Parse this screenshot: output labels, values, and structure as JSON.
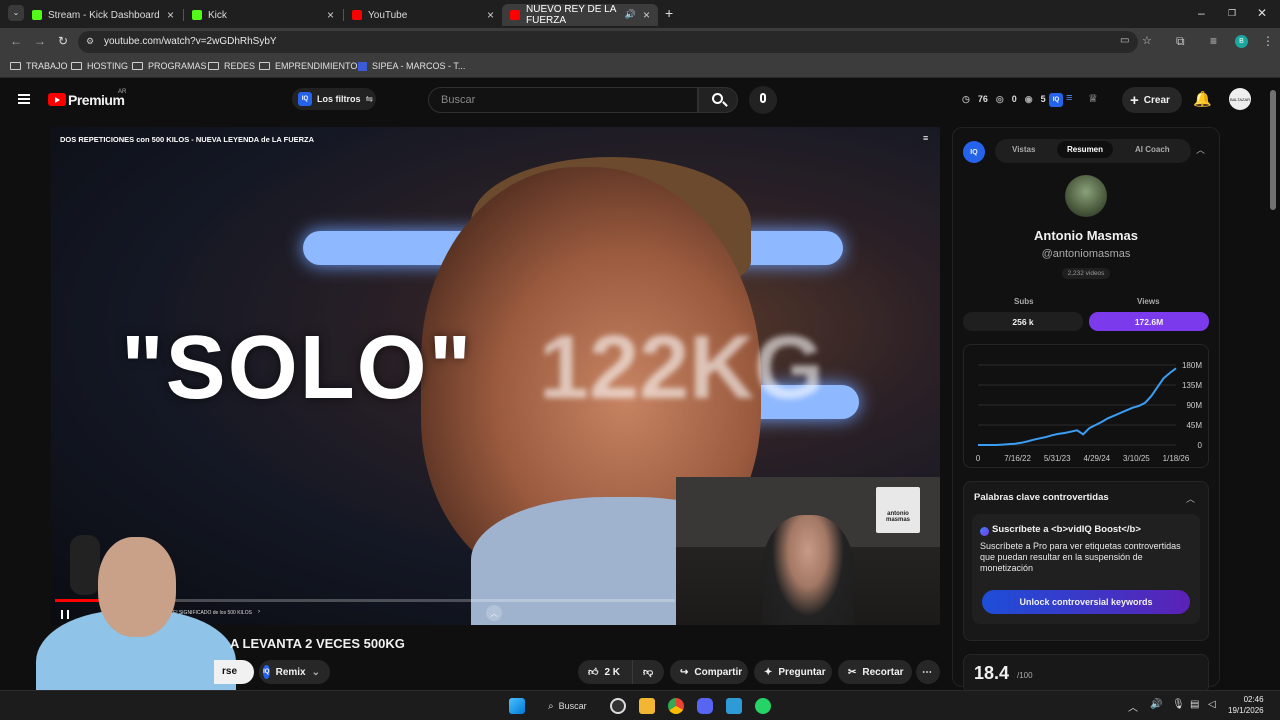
{
  "tabs": [
    {
      "title": "Stream - Kick Dashboard",
      "color": "#53fc18"
    },
    {
      "title": "Kick",
      "color": "#53fc18"
    },
    {
      "title": "YouTube",
      "color": "#ff0000"
    },
    {
      "title": "NUEVO REY DE LA FUERZA",
      "color": "#ff0000"
    }
  ],
  "address": {
    "url": "youtube.com/watch?v=2wGDhRhSybY"
  },
  "bookmarks": [
    "TRABAJO",
    "HOSTING",
    "PROGRAMAS",
    "REDES",
    "EMPRENDIMIENTOS",
    "SIPEA - MARCOS - T..."
  ],
  "youtube": {
    "brand": "Premium",
    "region": "AR",
    "filters_label": "Los filtros",
    "search_placeholder": "Buscar",
    "stats": {
      "time": "76",
      "a": "0",
      "b": "5"
    },
    "create_label": "Crear",
    "avatar_text": "BALTAZAR"
  },
  "video": {
    "overlay_title": "DOS REPETICIONES con 500 KILOS - NUEVA LEYENDA de LA FUERZA",
    "big_text": "\"SOLO\"",
    "big_text_blur": "122KG",
    "progress": 0.19,
    "chapter": "El SIGNIFICADO de los 500 KILOS",
    "time_fragment": "5",
    "cam_sign": "antonio masmas"
  },
  "below": {
    "title_fragment": "A LEVANTA 2 VECES 500KG",
    "subscribe_fragment": "rse",
    "remix": "Remix",
    "likes": "2 K",
    "share": "Compartir",
    "ask": "Preguntar",
    "clip": "Recortar"
  },
  "panel": {
    "iq": "IQ",
    "tabs": [
      "Vistas",
      "Resumen",
      "AI Coach"
    ],
    "active_tab": "Resumen",
    "channel_name": "Antonio Masmas",
    "handle": "@antoniomasmas",
    "videos": "2,232 videos",
    "subs_label": "Subs",
    "subs_value": "256 k",
    "views_label": "Views",
    "views_value": "172.6M",
    "keywords_title": "Palabras clave controvertidas",
    "boost_title": "Suscríbete a <b>vidIQ Boost</b>",
    "boost_desc": "Suscríbete a Pro para ver etiquetas controvertidas que puedan resultar en la suspensión de monetización",
    "unlock_label": "Unlock controversial keywords",
    "score": "18.4",
    "score_max": "/100",
    "accent": "#7c3aed"
  },
  "chart_data": {
    "type": "line",
    "x_labels": [
      "0",
      "7/16/22",
      "5/31/23",
      "4/29/24",
      "3/10/25",
      "1/18/26"
    ],
    "y_ticks": [
      "180M",
      "135M",
      "90M",
      "45M",
      "0"
    ],
    "ylim": [
      0,
      180
    ],
    "series": [
      {
        "values": [
          0,
          0,
          0,
          0,
          1,
          2,
          3,
          5,
          8,
          12,
          15,
          18,
          22,
          25,
          27,
          30,
          33,
          24,
          38,
          45,
          52,
          60,
          66,
          72,
          78,
          84,
          88,
          95,
          110,
          130,
          150,
          162,
          172.6
        ]
      }
    ],
    "grid": true,
    "color": "#3b9ef5"
  },
  "taskbar": {
    "search_label": "Buscar",
    "time": "02:46",
    "date": "19/1/2026"
  }
}
